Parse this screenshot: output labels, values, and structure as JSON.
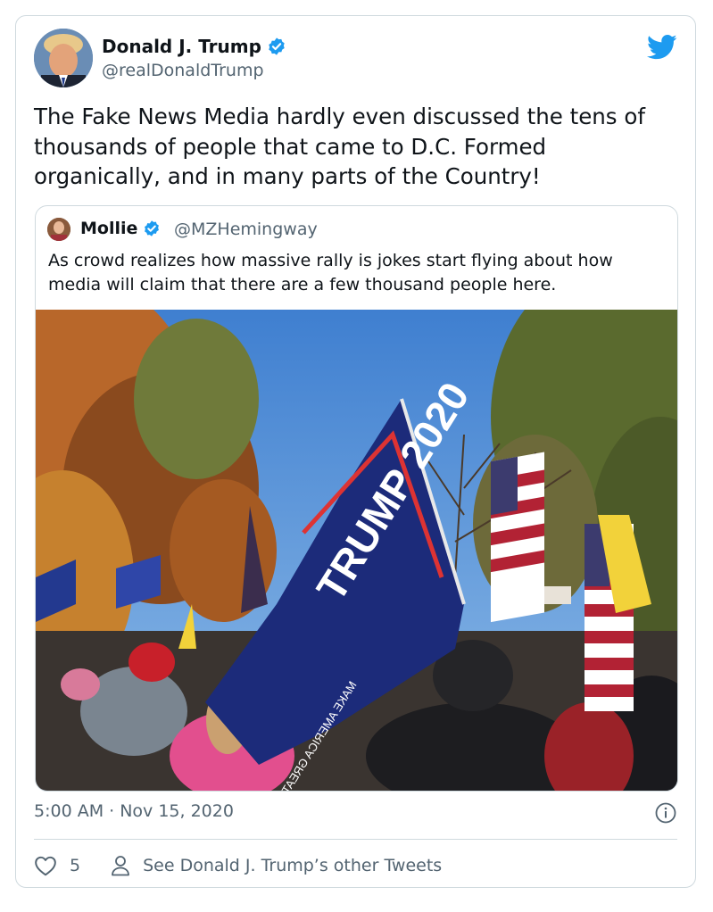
{
  "tweet": {
    "author": {
      "name": "Donald J. Trump",
      "handle": "@realDonaldTrump",
      "verified": true,
      "avatar_icon": "avatar-photo"
    },
    "text": "The Fake News Media hardly even discussed the tens of thousands of people that came to D.C. Formed organically, and in many parts of the Country!",
    "quoted": {
      "author": {
        "name": "Mollie",
        "handle": "@MZHemingway",
        "verified": true
      },
      "text": "As crowd realizes how massive rally is jokes start flying about how media will claim that there are a few thousand people here.",
      "photo": {
        "flag_text": "TRUMP 2020",
        "flag_subtext": "MAKE AMERICA GREAT AGAIN"
      }
    },
    "timestamp": "5:00 AM · Nov 15, 2020",
    "likes": "5",
    "other_tweets_label": "See Donald J. Trump’s other Tweets"
  },
  "colors": {
    "twitter_blue": "#1d9bf0",
    "text_primary": "#0f1419",
    "text_secondary": "#536471",
    "border": "#cfd9de"
  },
  "icons": [
    "twitter-bird-icon",
    "verified-badge-icon",
    "info-icon",
    "heart-icon",
    "person-icon"
  ]
}
